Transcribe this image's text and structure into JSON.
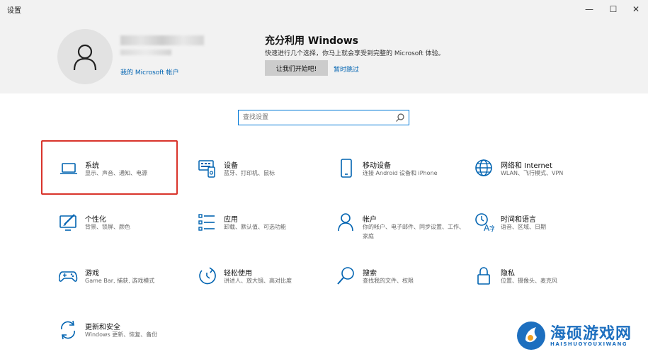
{
  "window": {
    "title": "设置",
    "minimize": "—",
    "maximize": "☐",
    "close": "✕"
  },
  "account": {
    "link": "我的 Microsoft 帐户"
  },
  "promo": {
    "title": "充分利用 Windows",
    "description": "快速进行几个选择，你马上就会享受到完整的 Microsoft 体验。",
    "primary": "让我们开始吧!",
    "secondary": "暂时跳过"
  },
  "search": {
    "placeholder": "查找设置"
  },
  "tiles": [
    {
      "icon": "laptop-icon",
      "title": "系统",
      "desc": "显示、声音、通知、电源"
    },
    {
      "icon": "devices-icon",
      "title": "设备",
      "desc": "蓝牙、打印机、鼠标"
    },
    {
      "icon": "phone-icon",
      "title": "移动设备",
      "desc": "连接 Android 设备和 iPhone"
    },
    {
      "icon": "globe-icon",
      "title": "网络和 Internet",
      "desc": "WLAN、飞行模式、VPN"
    },
    {
      "icon": "personalization-icon",
      "title": "个性化",
      "desc": "背景、锁屏、颜色"
    },
    {
      "icon": "apps-icon",
      "title": "应用",
      "desc": "卸载、默认值、可选功能"
    },
    {
      "icon": "person-icon",
      "title": "帐户",
      "desc": "你的帐户、电子邮件、同步设置、工作、"
    },
    {
      "icon": "time-language-icon",
      "title": "时间和语言",
      "desc": "语音、区域、日期"
    },
    {
      "icon": "gamepad-icon",
      "title": "游戏",
      "desc": "Game Bar, 捕获, 游戏模式"
    },
    {
      "icon": "ease-of-access-icon",
      "title": "轻松使用",
      "desc": "讲述人、放大镜、高对比度"
    },
    {
      "icon": "search-icon",
      "title": "搜索",
      "desc": "查找我的文件、权限"
    },
    {
      "icon": "lock-icon",
      "title": "隐私",
      "desc": "位置、摄像头、麦克风"
    },
    {
      "icon": "update-icon",
      "title": "更新和安全",
      "desc": "Windows 更新、恢复、备份"
    }
  ],
  "tile_desc_extra": {
    "account": "家庭"
  },
  "watermark": {
    "text": "海硕游戏网",
    "sub": "HAISHUOYOUXIWANG"
  },
  "colors": {
    "accent": "#0078d7",
    "link": "#0063b1",
    "highlight": "#d9342b"
  }
}
